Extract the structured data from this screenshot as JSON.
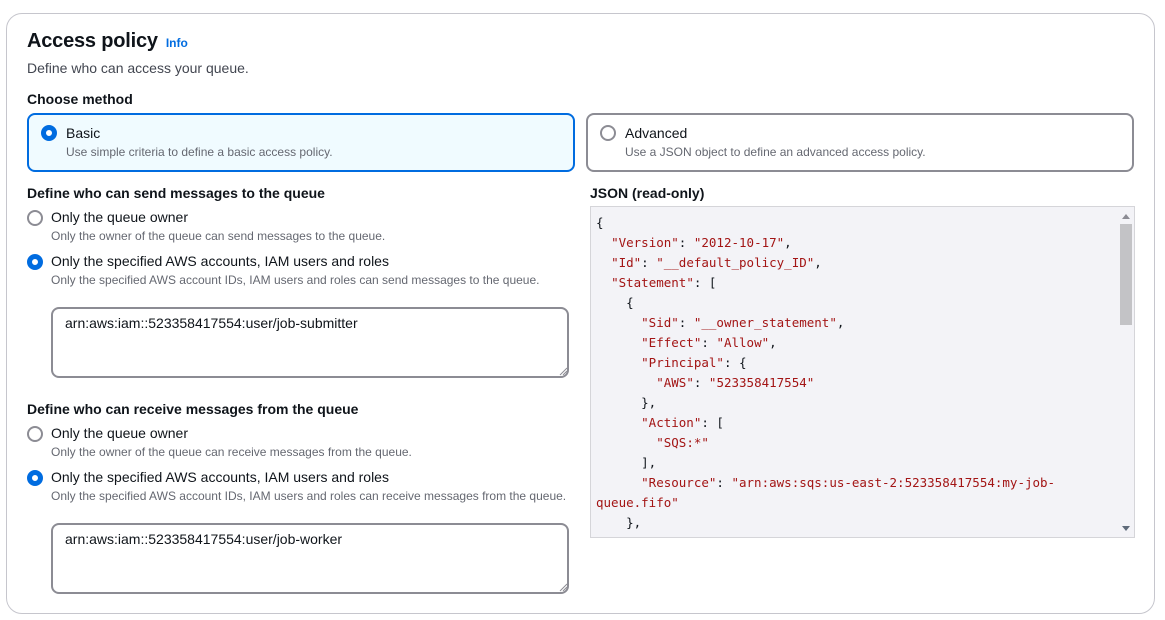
{
  "header": {
    "title": "Access policy",
    "info_label": "Info",
    "description": "Define who can access your queue."
  },
  "method": {
    "label": "Choose method",
    "options": [
      {
        "label": "Basic",
        "description": "Use simple criteria to define a basic access policy.",
        "selected": true
      },
      {
        "label": "Advanced",
        "description": "Use a JSON object to define an advanced access policy.",
        "selected": false
      }
    ]
  },
  "send": {
    "label": "Define who can send messages to the queue",
    "options": [
      {
        "label": "Only the queue owner",
        "description": "Only the owner of the queue can send messages to the queue.",
        "selected": false
      },
      {
        "label": "Only the specified AWS accounts, IAM users and roles",
        "description": "Only the specified AWS account IDs, IAM users and roles can send messages to the queue.",
        "selected": true
      }
    ],
    "principals_value": "arn:aws:iam::523358417554:user/job-submitter"
  },
  "receive": {
    "label": "Define who can receive messages from the queue",
    "options": [
      {
        "label": "Only the queue owner",
        "description": "Only the owner of the queue can receive messages from the queue.",
        "selected": false
      },
      {
        "label": "Only the specified AWS accounts, IAM users and roles",
        "description": "Only the specified AWS account IDs, IAM users and roles can receive messages from the queue.",
        "selected": true
      }
    ],
    "principals_value": "arn:aws:iam::523358417554:user/job-worker"
  },
  "json_view": {
    "label": "JSON (read-only)",
    "lines": [
      "{",
      "  \"Version\": \"2012-10-17\",",
      "  \"Id\": \"__default_policy_ID\",",
      "  \"Statement\": [",
      "    {",
      "      \"Sid\": \"__owner_statement\",",
      "      \"Effect\": \"Allow\",",
      "      \"Principal\": {",
      "        \"AWS\": \"523358417554\"",
      "      },",
      "      \"Action\": [",
      "        \"SQS:*\"",
      "      ],",
      "      \"Resource\": \"arn:aws:sqs:us-east-2:523358417554:my-job-",
      "queue.fifo\"",
      "    },",
      "    {"
    ]
  },
  "colors": {
    "accent": "#006ce0",
    "selected_tile_bg": "#f0fbff",
    "json_key": "#a31515"
  }
}
